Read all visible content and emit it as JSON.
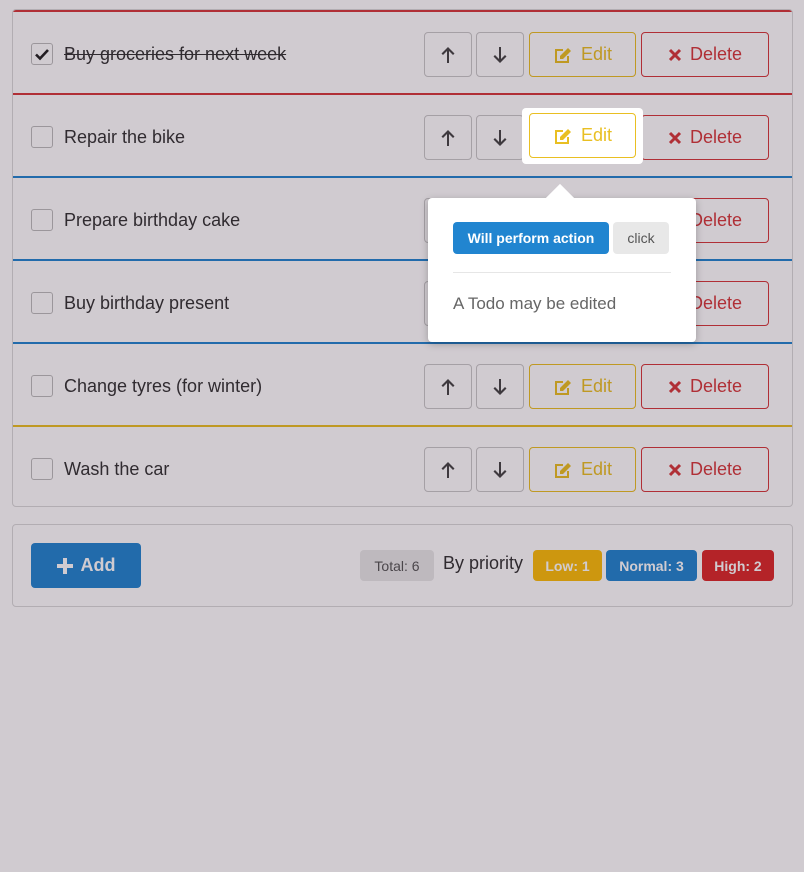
{
  "todos": [
    {
      "title": "Buy groceries for next week",
      "done": true,
      "priority": "high"
    },
    {
      "title": "Repair the bike",
      "done": false,
      "priority": "high"
    },
    {
      "title": "Prepare birthday cake",
      "done": false,
      "priority": "normal"
    },
    {
      "title": "Buy birthday present",
      "done": false,
      "priority": "normal"
    },
    {
      "title": "Change tyres (for winter)",
      "done": false,
      "priority": "normal"
    },
    {
      "title": "Wash the car",
      "done": false,
      "priority": "low"
    }
  ],
  "buttons": {
    "edit": "Edit",
    "delete": "Delete",
    "add": "Add"
  },
  "footer": {
    "total": "Total: 6",
    "by_priority": "By priority",
    "low": "Low: 1",
    "normal": "Normal: 3",
    "high": "High: 2"
  },
  "popup": {
    "action_label": "Will perform action",
    "action_type": "click",
    "description": "A Todo may be edited"
  },
  "colors": {
    "high": "#d6383a",
    "normal": "#2185d0",
    "low": "#e9bf22",
    "primary": "#2185d0"
  },
  "icons": {
    "up": "arrow-up-icon",
    "down": "arrow-down-icon",
    "edit": "pencil-square-icon",
    "delete": "x-icon",
    "add": "plus-icon",
    "check": "checkmark-icon"
  }
}
